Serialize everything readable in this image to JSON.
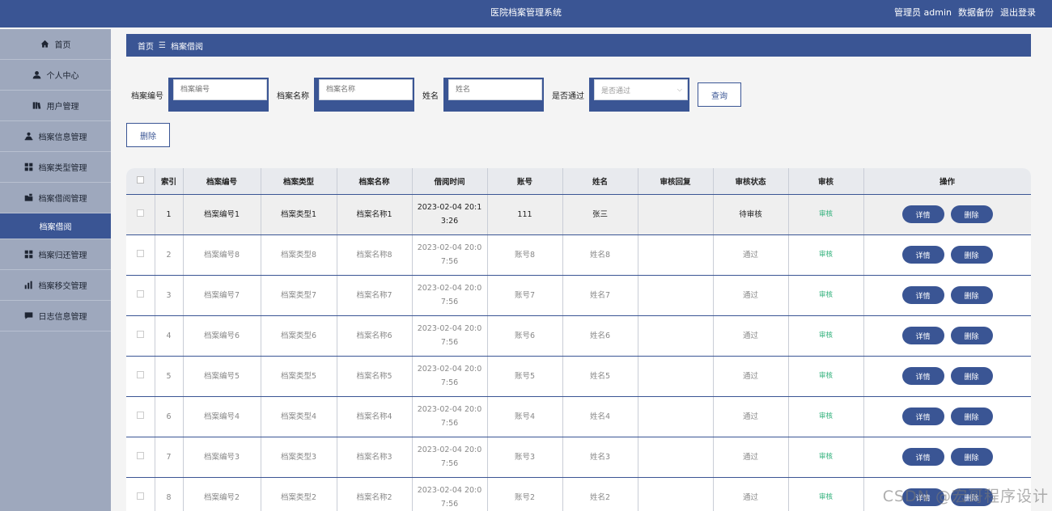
{
  "header": {
    "title": "医院档案管理系统",
    "user": "管理员 admin",
    "backup": "数据备份",
    "logout": "退出登录"
  },
  "sidebar": {
    "items": [
      {
        "label": "首页",
        "icon": "home-icon"
      },
      {
        "label": "个人中心",
        "icon": "user-icon"
      },
      {
        "label": "用户管理",
        "icon": "book-icon"
      },
      {
        "label": "档案信息管理",
        "icon": "person-icon"
      },
      {
        "label": "档案类型管理",
        "icon": "grid-icon"
      },
      {
        "label": "档案借阅管理",
        "icon": "folder-icon"
      },
      {
        "label": "档案借阅",
        "icon": ""
      },
      {
        "label": "档案归还管理",
        "icon": "grid-icon"
      },
      {
        "label": "档案移交管理",
        "icon": "bar-chart-icon"
      },
      {
        "label": "日志信息管理",
        "icon": "comment-icon"
      }
    ]
  },
  "breadcrumb": {
    "home": "首页",
    "sep": "☰",
    "current": "档案借阅"
  },
  "search": {
    "fields": [
      {
        "label": "档案编号",
        "placeholder": "档案编号"
      },
      {
        "label": "档案名称",
        "placeholder": "档案名称"
      },
      {
        "label": "姓名",
        "placeholder": "姓名"
      }
    ],
    "pass_label": "是否通过",
    "pass_placeholder": "是否通过",
    "query": "查询"
  },
  "actions": {
    "delete": "删除"
  },
  "table": {
    "headers": [
      "索引",
      "档案编号",
      "档案类型",
      "档案名称",
      "借阅时间",
      "账号",
      "姓名",
      "审核回复",
      "审核状态",
      "审核",
      "操作"
    ],
    "audit_link": "审核",
    "detail_btn": "详情",
    "delete_btn": "删除",
    "rows": [
      {
        "index": "1",
        "code": "档案编号1",
        "type": "档案类型1",
        "name": "档案名称1",
        "time1": "2023-02-04 20:1",
        "time2": "3:26",
        "account": "111",
        "person": "张三",
        "reply": "",
        "status": "待审核"
      },
      {
        "index": "2",
        "code": "档案编号8",
        "type": "档案类型8",
        "name": "档案名称8",
        "time1": "2023-02-04 20:0",
        "time2": "7:56",
        "account": "账号8",
        "person": "姓名8",
        "reply": "",
        "status": "通过"
      },
      {
        "index": "3",
        "code": "档案编号7",
        "type": "档案类型7",
        "name": "档案名称7",
        "time1": "2023-02-04 20:0",
        "time2": "7:56",
        "account": "账号7",
        "person": "姓名7",
        "reply": "",
        "status": "通过"
      },
      {
        "index": "4",
        "code": "档案编号6",
        "type": "档案类型6",
        "name": "档案名称6",
        "time1": "2023-02-04 20:0",
        "time2": "7:56",
        "account": "账号6",
        "person": "姓名6",
        "reply": "",
        "status": "通过"
      },
      {
        "index": "5",
        "code": "档案编号5",
        "type": "档案类型5",
        "name": "档案名称5",
        "time1": "2023-02-04 20:0",
        "time2": "7:56",
        "account": "账号5",
        "person": "姓名5",
        "reply": "",
        "status": "通过"
      },
      {
        "index": "6",
        "code": "档案编号4",
        "type": "档案类型4",
        "name": "档案名称4",
        "time1": "2023-02-04 20:0",
        "time2": "7:56",
        "account": "账号4",
        "person": "姓名4",
        "reply": "",
        "status": "通过"
      },
      {
        "index": "7",
        "code": "档案编号3",
        "type": "档案类型3",
        "name": "档案名称3",
        "time1": "2023-02-04 20:0",
        "time2": "7:56",
        "account": "账号3",
        "person": "姓名3",
        "reply": "",
        "status": "通过"
      },
      {
        "index": "8",
        "code": "档案编号2",
        "type": "档案类型2",
        "name": "档案名称2",
        "time1": "2023-02-04 20:0",
        "time2": "7:56",
        "account": "账号2",
        "person": "姓名2",
        "reply": "",
        "status": "通过"
      }
    ]
  },
  "watermark": "CSDN @宏哥程序设计",
  "colors": {
    "primary": "#3a5594",
    "sidebar": "#9ea8bd",
    "audit": "#2fb07a"
  }
}
